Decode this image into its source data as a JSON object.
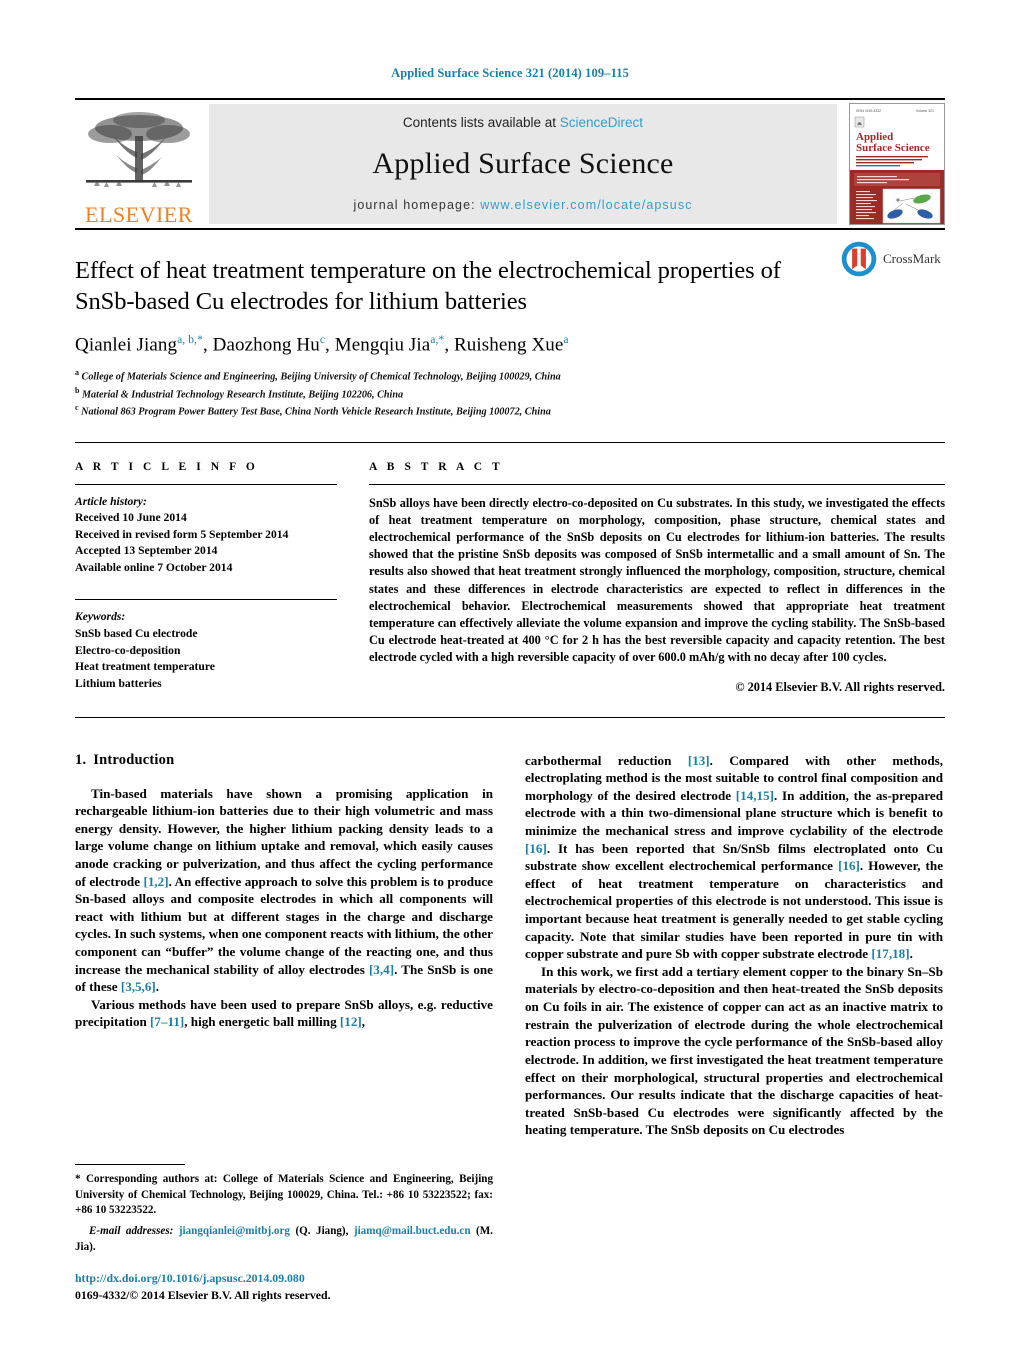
{
  "running_head": "Applied Surface Science 321 (2014) 109–115",
  "masthead": {
    "publisher_name": "ELSEVIER",
    "contents_prefix": "Contents lists available at",
    "contents_link": "ScienceDirect",
    "journal_name": "Applied Surface Science",
    "homepage_prefix": "journal homepage:",
    "homepage_url": "www.elsevier.com/locate/apsusc",
    "cover": {
      "title_line1": "Applied",
      "title_line2": "Surface Science"
    }
  },
  "title_block": {
    "title": "Effect of heat treatment temperature on the electrochemical properties of SnSb-based Cu electrodes for lithium batteries",
    "crossmark_label": "CrossMark",
    "authors": [
      {
        "name": "Qianlei Jiang",
        "marks": "a, b,*",
        "sep": ", "
      },
      {
        "name": "Daozhong Hu",
        "marks": "c",
        "sep": ", "
      },
      {
        "name": "Mengqiu Jia",
        "marks": "a,*",
        "sep": ", "
      },
      {
        "name": "Ruisheng Xue",
        "marks": "a",
        "sep": ""
      }
    ],
    "affiliations": [
      {
        "mark": "a",
        "text": "College of Materials Science and Engineering, Beijing University of Chemical Technology, Beijing 100029, China"
      },
      {
        "mark": "b",
        "text": "Material & Industrial Technology Research Institute, Beijing 102206, China"
      },
      {
        "mark": "c",
        "text": "National 863 Program Power Battery Test Base, China North Vehicle Research Institute, Beijing 100072, China"
      }
    ]
  },
  "article_info": {
    "heading": "A R T I C L E    I N F O",
    "history_label": "Article history:",
    "history": [
      "Received 10 June 2014",
      "Received in revised form 5 September 2014",
      "Accepted 13 September 2014",
      "Available online 7 October 2014"
    ],
    "keywords_label": "Keywords:",
    "keywords": [
      "SnSb based Cu electrode",
      "Electro-co-deposition",
      "Heat treatment temperature",
      "Lithium batteries"
    ]
  },
  "abstract": {
    "heading": "A B S T R A C T",
    "text": "SnSb alloys have been directly electro-co-deposited on Cu substrates. In this study, we investigated the effects of heat treatment temperature on morphology, composition, phase structure, chemical states and electrochemical performance of the SnSb deposits on Cu electrodes for lithium-ion batteries. The results showed that the pristine SnSb deposits was composed of SnSb intermetallic and a small amount of Sn. The results also showed that heat treatment strongly influenced the morphology, composition, structure, chemical states and these differences in electrode characteristics are expected to reflect in differences in the electrochemical behavior. Electrochemical measurements showed that appropriate heat treatment temperature can effectively alleviate the volume expansion and improve the cycling stability. The SnSb-based Cu electrode heat-treated at 400 °C for 2 h has the best reversible capacity and capacity retention. The best electrode cycled with a high reversible capacity of over 600.0 mAh/g with no decay after 100 cycles.",
    "copyright": "© 2014 Elsevier B.V. All rights reserved."
  },
  "introduction": {
    "number": "1.",
    "title": "Introduction",
    "left_paragraphs": [
      "Tin-based materials have shown a promising application in rechargeable lithium-ion batteries due to their high volumetric and mass energy density. However, the higher lithium packing density leads to a large volume change on lithium uptake and removal, which easily causes anode cracking or pulverization, and thus affect the cycling performance of electrode [1,2]. An effective approach to solve this problem is to produce Sn-based alloys and composite electrodes in which all components will react with lithium but at different stages in the charge and discharge cycles. In such systems, when one component reacts with lithium, the other component can \"buffer\" the volume change of the reacting one, and thus increase the mechanical stability of alloy electrodes [3,4]. The SnSb is one of these [3,5,6].",
      "Various methods have been used to prepare SnSb alloys, e.g. reductive precipitation [7–11], high energetic ball milling [12],"
    ],
    "right_paragraphs": [
      "carbothermal reduction [13]. Compared with other methods, electroplating method is the most suitable to control final composition and morphology of the desired electrode [14,15]. In addition, the as-prepared electrode with a thin two-dimensional plane structure which is benefit to minimize the mechanical stress and improve cyclability of the electrode [16]. It has been reported that Sn/SnSb films electroplated onto Cu substrate show excellent electrochemical performance [16]. However, the effect of heat treatment temperature on characteristics and electrochemical properties of this electrode is not understood. This issue is important because heat treatment is generally needed to get stable cycling capacity. Note that similar studies have been reported in pure tin with copper substrate and pure Sb with copper substrate electrode [17,18].",
      "In this work, we first add a tertiary element copper to the binary Sn–Sb materials by electro-co-deposition and then heat-treated the SnSb deposits on Cu foils in air. The existence of copper can act as an inactive matrix to restrain the pulverization of electrode during the whole electrochemical reaction process to improve the cycle performance of the SnSb-based alloy electrode. In addition, we first investigated the heat treatment temperature effect on their morphological, structural properties and electrochemical performances. Our results indicate that the discharge capacities of heat-treated SnSb-based Cu electrodes were significantly affected by the heating temperature. The SnSb deposits on Cu electrodes"
    ]
  },
  "footnote": {
    "corresponding": "* Corresponding authors at: College of Materials Science and Engineering, Beijing University of Chemical Technology, Beijing 100029, China. Tel.: +86 10 53223522; fax: +86 10 53223522.",
    "email_label": "E-mail addresses:",
    "email1": "jiangqianlei@mitbj.org",
    "email1_owner": "(Q. Jiang),",
    "email2": "jiamq@mail.buct.edu.cn",
    "email2_owner": "(M. Jia)."
  },
  "footer": {
    "doi": "http://dx.doi.org/10.1016/j.apsusc.2014.09.080",
    "issn_line": "0169-4332/© 2014 Elsevier B.V. All rights reserved."
  },
  "colors": {
    "link_blue": "#1a7fa8",
    "sciencedirect_blue": "#2e9fd0",
    "elsevier_orange": "#F08122",
    "cover_red": "#9c2b26"
  }
}
